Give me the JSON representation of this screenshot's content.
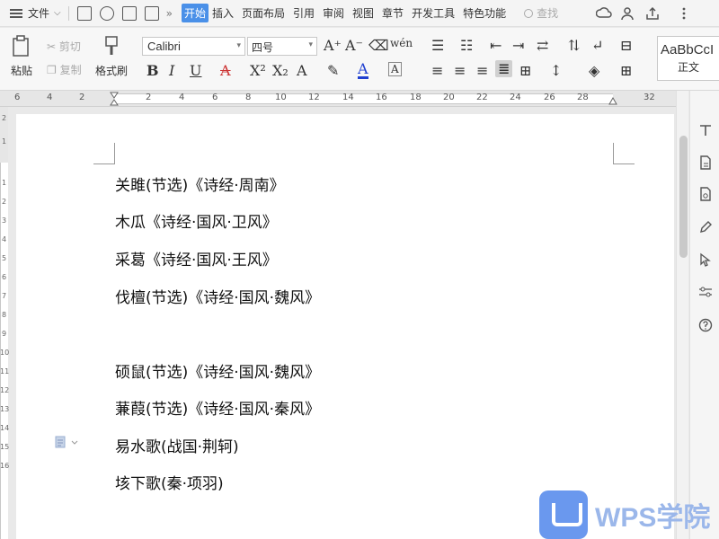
{
  "menu": {
    "file_label": "文件",
    "tabs": [
      "开始",
      "插入",
      "页面布局",
      "引用",
      "审阅",
      "视图",
      "章节",
      "开发工具",
      "特色功能"
    ],
    "active_tab": "开始",
    "search_label": "查找"
  },
  "ribbon": {
    "paste_label": "粘贴",
    "cut_label": "剪切",
    "copy_label": "复制",
    "format_painter_label": "格式刷",
    "font_name": "Calibri",
    "font_size": "四号",
    "style_sample": "AaBbCcI",
    "style_name": "正文"
  },
  "ruler": {
    "numbers": [
      "6",
      "4",
      "2",
      "2",
      "4",
      "6",
      "8",
      "10",
      "12",
      "14",
      "16",
      "18",
      "20",
      "22",
      "24",
      "26",
      "28",
      "32"
    ]
  },
  "vruler": {
    "numbers": [
      "2",
      "1",
      "1",
      "2",
      "3",
      "4",
      "5",
      "6",
      "7",
      "8",
      "9",
      "10",
      "11",
      "12",
      "13",
      "14",
      "15",
      "16"
    ]
  },
  "document": {
    "lines": [
      "关雎(节选)《诗经·周南》",
      "木瓜《诗经·国风·卫风》",
      "采葛《诗经·国风·王风》",
      "伐檀(节选)《诗经·国风·魏风》",
      "硕鼠(节选)《诗经·国风·魏风》",
      "蒹葭(节选)《诗经·国风·秦风》",
      "易水歌(战国·荆轲)",
      "垓下歌(秦·项羽)"
    ]
  },
  "watermark": {
    "text": "WPS学院"
  },
  "colors": {
    "accent": "#4a90e8",
    "watermark": "#9bb7ea"
  }
}
